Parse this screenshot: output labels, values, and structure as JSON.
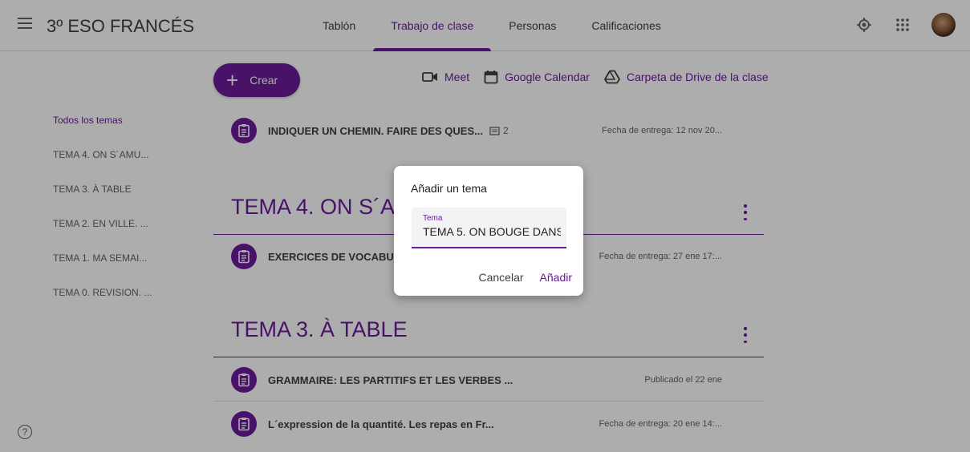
{
  "header": {
    "class_title": "3º ESO FRANCÉS",
    "tabs": [
      {
        "label": "Tablón"
      },
      {
        "label": "Trabajo de clase"
      },
      {
        "label": "Personas"
      },
      {
        "label": "Calificaciones"
      }
    ]
  },
  "toolbar": {
    "create_label": "Crear",
    "meet_label": "Meet",
    "calendar_label": "Google Calendar",
    "drive_label": "Carpeta de Drive de la clase"
  },
  "sidebar": {
    "items": [
      {
        "label": "Todos los temas"
      },
      {
        "label": "TEMA 4. ON S´AMU..."
      },
      {
        "label": "TEMA 3. À TABLE"
      },
      {
        "label": "TEMA 2. EN VILLE. ..."
      },
      {
        "label": "TEMA 1. MA SEMAI..."
      },
      {
        "label": "TEMA 0. REVISION. ..."
      }
    ]
  },
  "content": {
    "task_top": {
      "title": "INDIQUER UN CHEMIN. FAIRE DES QUES...",
      "comments": "2",
      "due": "Fecha de entrega: 12 nov 20..."
    },
    "topic4": {
      "title": "TEMA 4. ON S´AMUSE",
      "tasks": [
        {
          "title": "EXERCICES DE VOCABULAIRE",
          "due": "Fecha de entrega: 27 ene 17:..."
        }
      ]
    },
    "topic3": {
      "title": "TEMA 3. À TABLE",
      "tasks": [
        {
          "title": "GRAMMAIRE: LES PARTITIFS ET LES VERBES ...",
          "due": "Publicado el 22 ene"
        },
        {
          "title": "L´expression de la quantité. Les repas en Fr...",
          "due": "Fecha de entrega: 20 ene 14:..."
        }
      ]
    }
  },
  "dialog": {
    "title": "Añadir un tema",
    "field_label": "Tema",
    "field_value": "TEMA 5. ON BOUGE DANS",
    "cancel_label": "Cancelar",
    "add_label": "Añadir"
  },
  "help_icon": "?",
  "colors": {
    "accent": "#6a1b9a",
    "overlay": "rgba(0,0,0,0.32)"
  }
}
